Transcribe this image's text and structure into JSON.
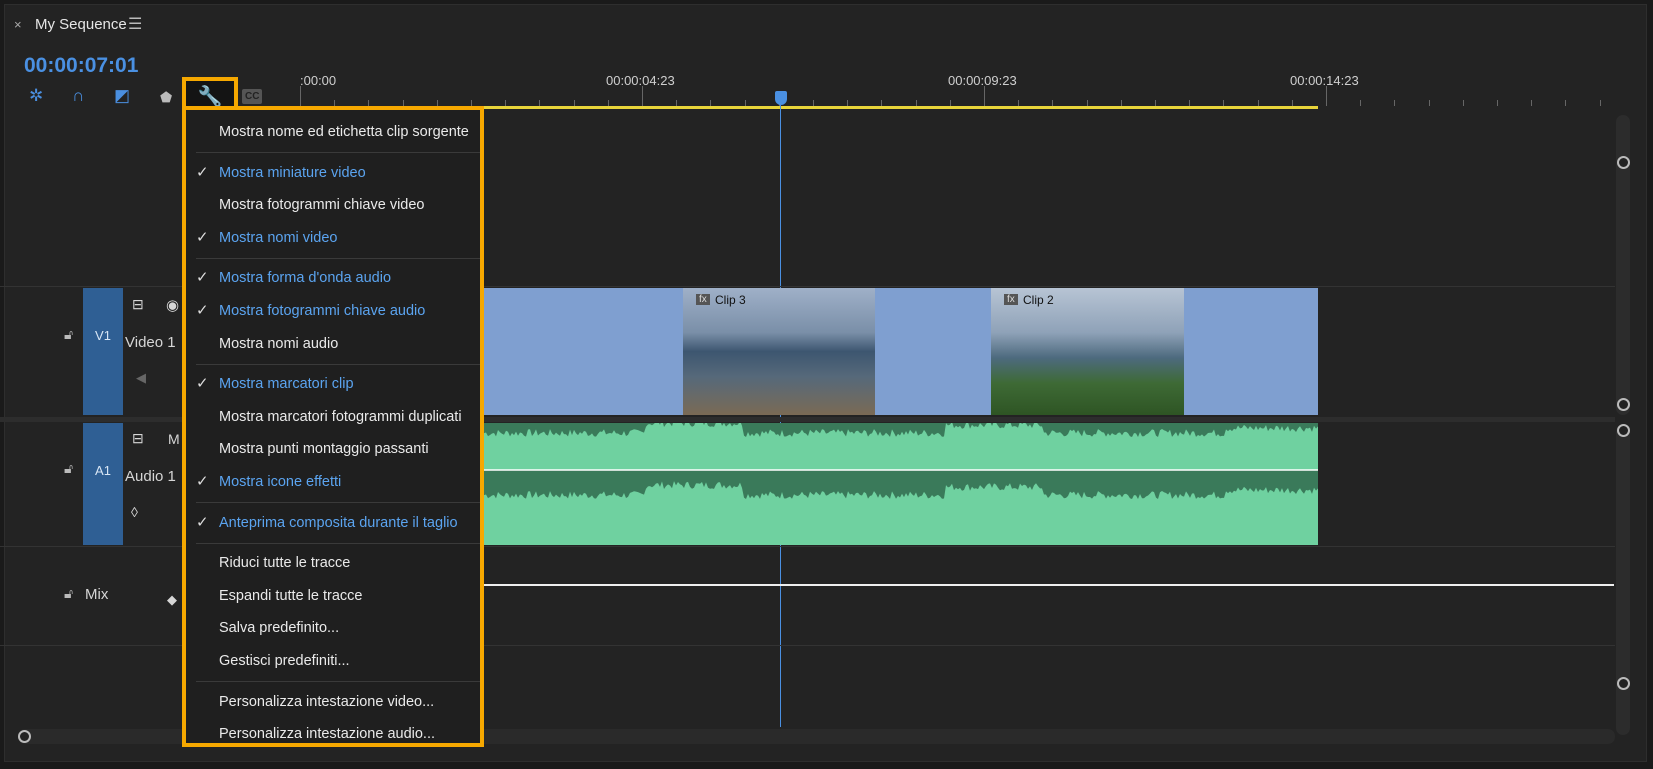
{
  "panel": {
    "title": "My Sequence",
    "timecode": "00:00:07:01"
  },
  "ruler": {
    "labels": [
      ":00:00",
      "00:00:04:23",
      "00:00:09:23",
      "00:00:14:23"
    ]
  },
  "toolbar": {
    "cc_label": "CC"
  },
  "tracks": {
    "video": {
      "id": "V1",
      "name": "Video 1"
    },
    "audio": {
      "id": "A1",
      "name": "Audio 1",
      "mute": "M"
    },
    "mix": {
      "name": "Mix"
    }
  },
  "clips": [
    {
      "name": "Clip 3",
      "fx": "fx"
    },
    {
      "name": "Clip 2",
      "fx": "fx"
    }
  ],
  "menu": {
    "items": [
      {
        "label": "Mostra nome ed etichetta clip sorgente",
        "checked": false
      },
      {
        "label": "Mostra miniature video",
        "checked": true
      },
      {
        "label": "Mostra fotogrammi chiave video",
        "checked": false
      },
      {
        "label": "Mostra nomi video",
        "checked": true
      },
      {
        "label": "Mostra forma d'onda audio",
        "checked": true
      },
      {
        "label": "Mostra fotogrammi chiave audio",
        "checked": true
      },
      {
        "label": "Mostra nomi audio",
        "checked": false
      },
      {
        "label": "Mostra marcatori clip",
        "checked": true
      },
      {
        "label": "Mostra marcatori fotogrammi duplicati",
        "checked": false
      },
      {
        "label": "Mostra punti montaggio passanti",
        "checked": false
      },
      {
        "label": "Mostra icone effetti",
        "checked": true
      },
      {
        "label": "Anteprima composita durante il taglio",
        "checked": true
      },
      {
        "label": "Riduci tutte le tracce",
        "checked": false
      },
      {
        "label": "Espandi tutte le tracce",
        "checked": false
      },
      {
        "label": "Salva predefinito...",
        "checked": false
      },
      {
        "label": "Gestisci predefiniti...",
        "checked": false
      },
      {
        "label": "Personalizza intestazione video...",
        "checked": false
      },
      {
        "label": "Personalizza intestazione audio...",
        "checked": false
      }
    ],
    "check_glyph": "✓"
  },
  "colors": {
    "accent": "#4a90e2",
    "highlight": "#f6a800",
    "video_clip": "#7f9fd0",
    "audio_clip": "#3a7a5a",
    "waveform": "#6fd1a0"
  }
}
